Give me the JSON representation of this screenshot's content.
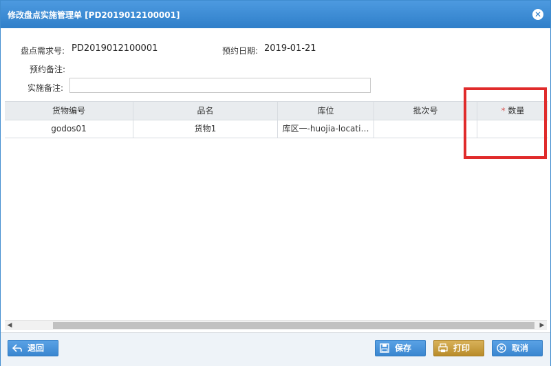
{
  "dialog": {
    "title": "修改盘点实施管理单 [PD2019012100001]",
    "close_icon": "close-icon"
  },
  "form": {
    "demand_no_label": "盘点需求号:",
    "demand_no_value": "PD2019012100001",
    "date_label": "预约日期:",
    "date_value": "2019-01-21",
    "reserve_note_label": "预约备注:",
    "impl_note_label": "实施备注:",
    "impl_note_value": ""
  },
  "table": {
    "columns": [
      {
        "label": "货物编号"
      },
      {
        "label": "品名"
      },
      {
        "label": "库位"
      },
      {
        "label": "批次号"
      },
      {
        "label": "数量",
        "required_mark": "*"
      }
    ],
    "rows": [
      {
        "code": "godos01",
        "name": "货物1",
        "location": "库区一-huojia-locati…",
        "batch": "",
        "qty": ""
      }
    ]
  },
  "footer": {
    "back_label": "退回",
    "save_label": "保存",
    "print_label": "打印",
    "cancel_label": "取消"
  },
  "colors": {
    "title_bar": "#3a87d0",
    "button": "#3a86d0",
    "highlight": "#e02b2b"
  }
}
